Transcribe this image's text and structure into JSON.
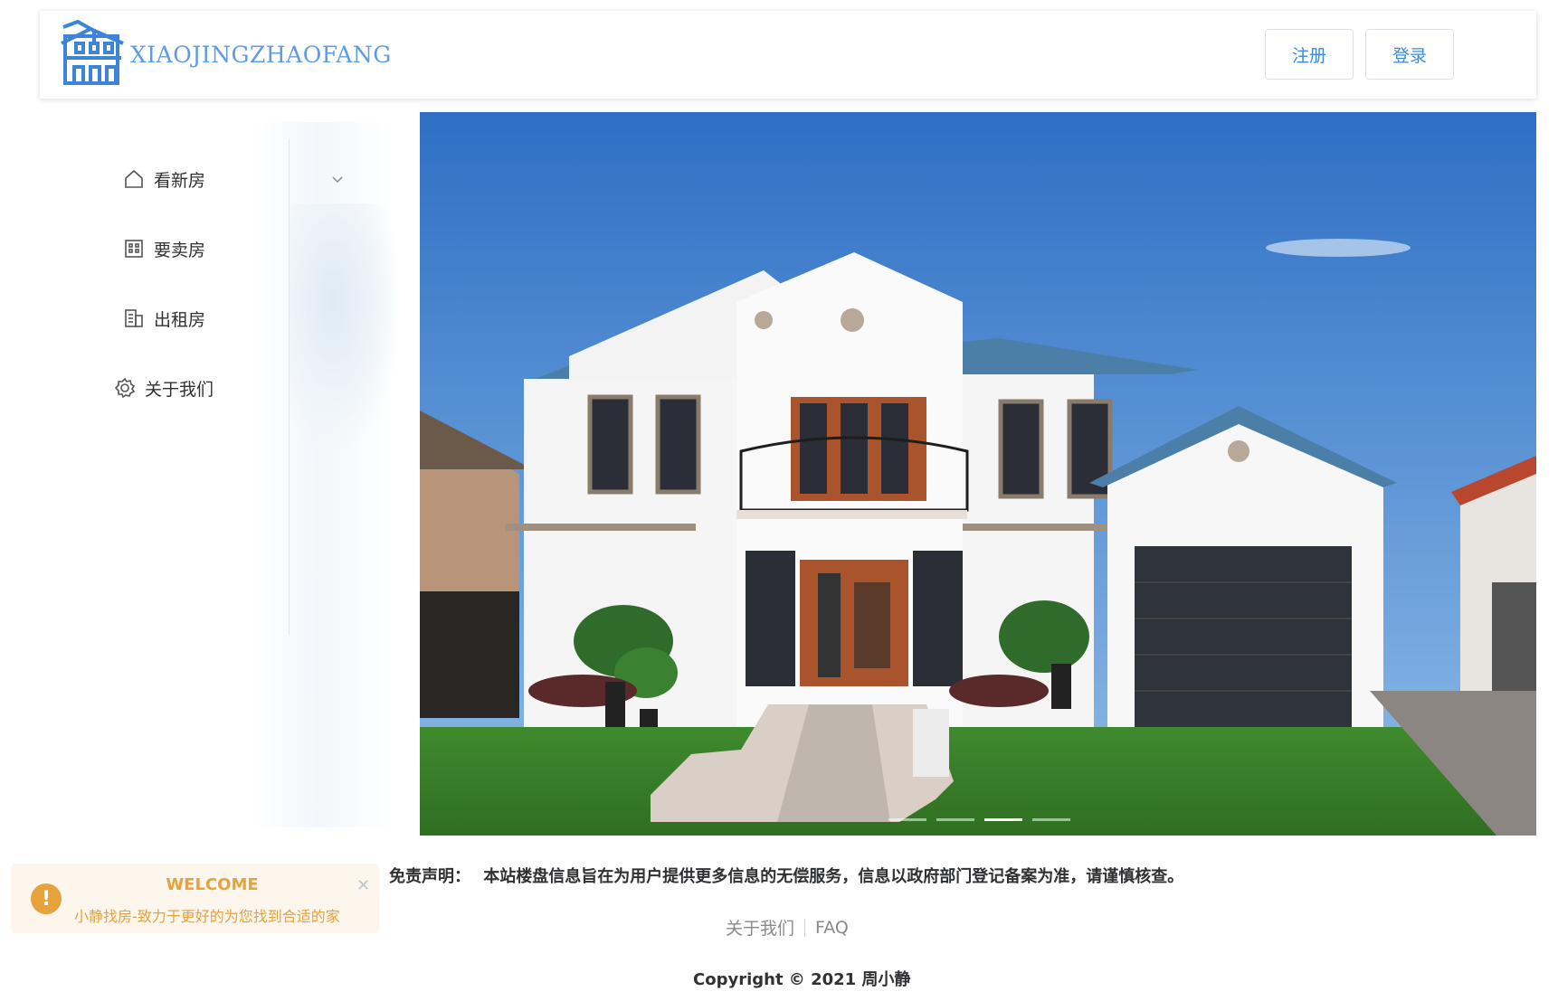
{
  "header": {
    "logo_text": "XIAOJINGZHAOFANG",
    "register_label": "注册",
    "login_label": "登录"
  },
  "menu": {
    "items": [
      {
        "label": "看新房",
        "icon": "home-icon",
        "has_submenu": true
      },
      {
        "label": "要卖房",
        "icon": "building-icon"
      },
      {
        "label": "出租房",
        "icon": "office-icon"
      },
      {
        "label": "关于我们",
        "icon": "gear-icon"
      }
    ]
  },
  "carousel": {
    "slide_count": 4,
    "active_index": 2
  },
  "disclaimer": {
    "label": "免责声明：",
    "text": "本站楼盘信息旨在为用户提供更多信息的无偿服务，信息以政府部门登记备案为准，请谨慎核查。"
  },
  "footer": {
    "about_link": "关于我们",
    "faq_link": "FAQ",
    "copyright": "Copyright © 2021 周小静"
  },
  "notification": {
    "title": "WELCOME",
    "message": "小静找房-致力于更好的为您找到合适的家",
    "type": "warning",
    "color": "#e6a23c"
  },
  "colors": {
    "accent": "#3b8ad9",
    "logo": "#5c9ce6",
    "warning": "#e6a23c"
  }
}
